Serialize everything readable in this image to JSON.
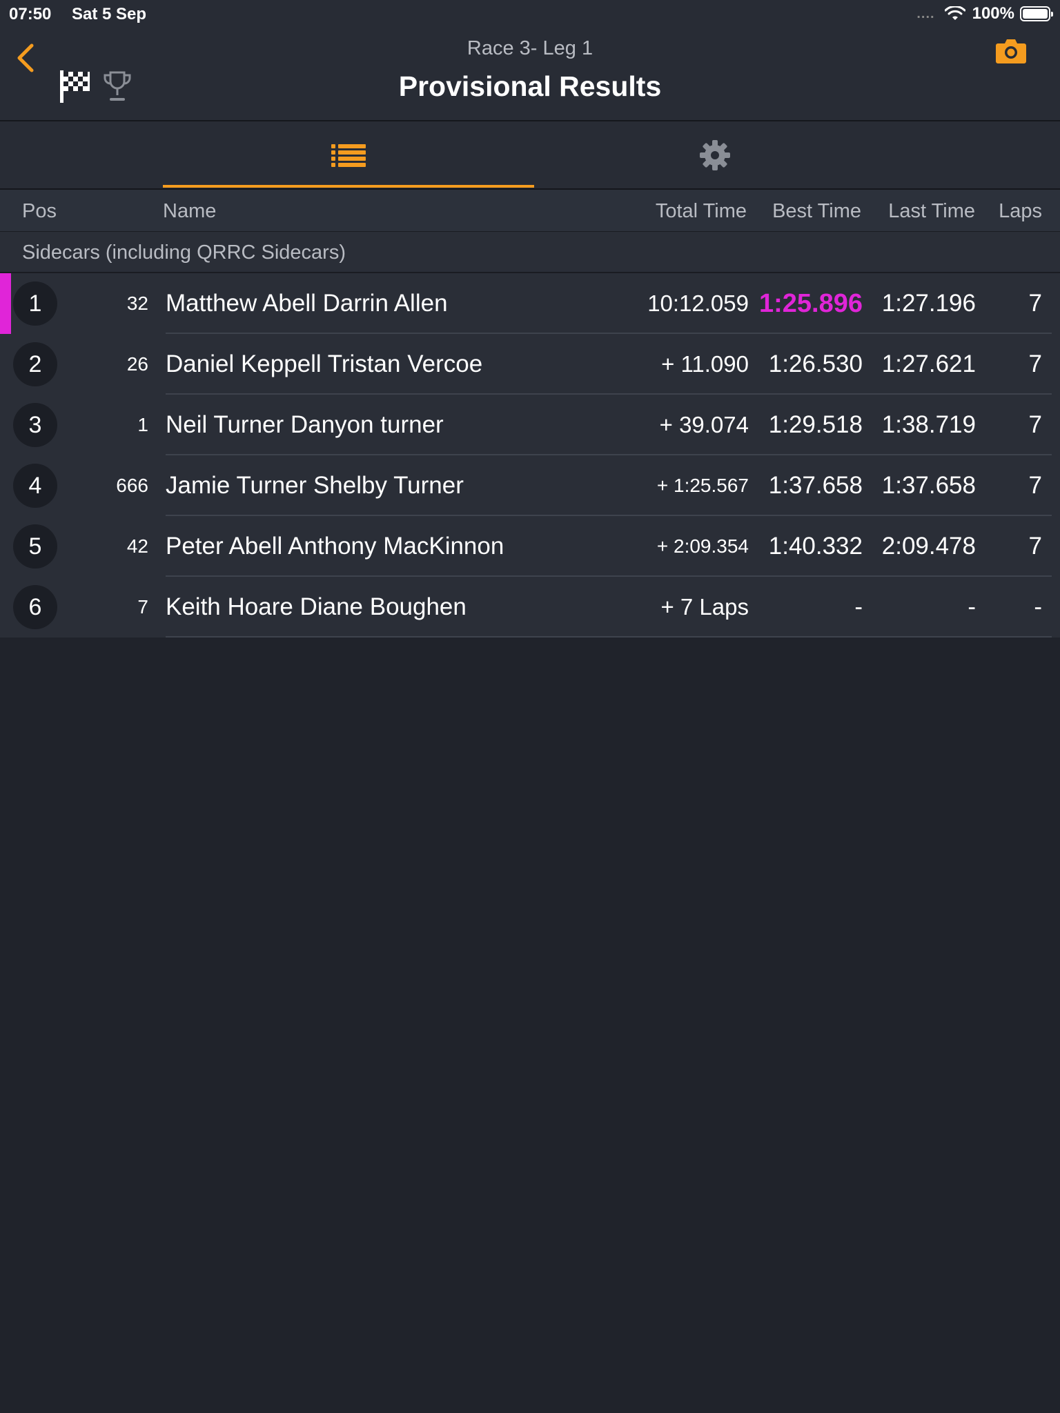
{
  "status_bar": {
    "time": "07:50",
    "date": "Sat 5 Sep",
    "signal": "....",
    "battery": "100%"
  },
  "nav": {
    "subtitle": "Race 3-  Leg 1",
    "title": "Provisional Results",
    "icons": {
      "back": "chevron-left-icon",
      "flag": "checkered-flag-icon",
      "trophy": "trophy-icon",
      "camera": "camera-icon"
    }
  },
  "tabs": [
    {
      "id": "results-list",
      "icon": "list-icon",
      "selected": true
    },
    {
      "id": "settings",
      "icon": "gear-icon",
      "selected": false
    }
  ],
  "table": {
    "headers": {
      "pos": "Pos",
      "name": "Name",
      "total": "Total Time",
      "best": "Best Time",
      "last": "Last Time",
      "laps": "Laps"
    },
    "group": "Sidecars (including QRRC Sidecars)",
    "rows": [
      {
        "pos": "1",
        "num": "32",
        "name": "Matthew Abell Darrin Allen",
        "total": "10:12.059",
        "best": "1:25.896",
        "last": "1:27.196",
        "laps": "7"
      },
      {
        "pos": "2",
        "num": "26",
        "name": "Daniel Keppell Tristan Vercoe",
        "total": "+ 11.090",
        "best": "1:26.530",
        "last": "1:27.621",
        "laps": "7"
      },
      {
        "pos": "3",
        "num": "1",
        "name": "Neil Turner Danyon turner",
        "total": "+ 39.074",
        "best": "1:29.518",
        "last": "1:38.719",
        "laps": "7"
      },
      {
        "pos": "4",
        "num": "666",
        "name": "Jamie Turner Shelby Turner",
        "total": "+ 1:25.567",
        "best": "1:37.658",
        "last": "1:37.658",
        "laps": "7"
      },
      {
        "pos": "5",
        "num": "42",
        "name": "Peter Abell Anthony MacKinnon",
        "total": "+ 2:09.354",
        "best": "1:40.332",
        "last": "2:09.478",
        "laps": "7"
      },
      {
        "pos": "6",
        "num": "7",
        "name": "Keith Hoare Diane Boughen",
        "total": "+ 7 Laps",
        "best": "-",
        "last": "-",
        "laps": "-"
      }
    ]
  },
  "colors": {
    "accent": "#f59c1f",
    "fastest_lap": "#e025d8",
    "background": "#20232b",
    "row": "#2a2e37"
  }
}
